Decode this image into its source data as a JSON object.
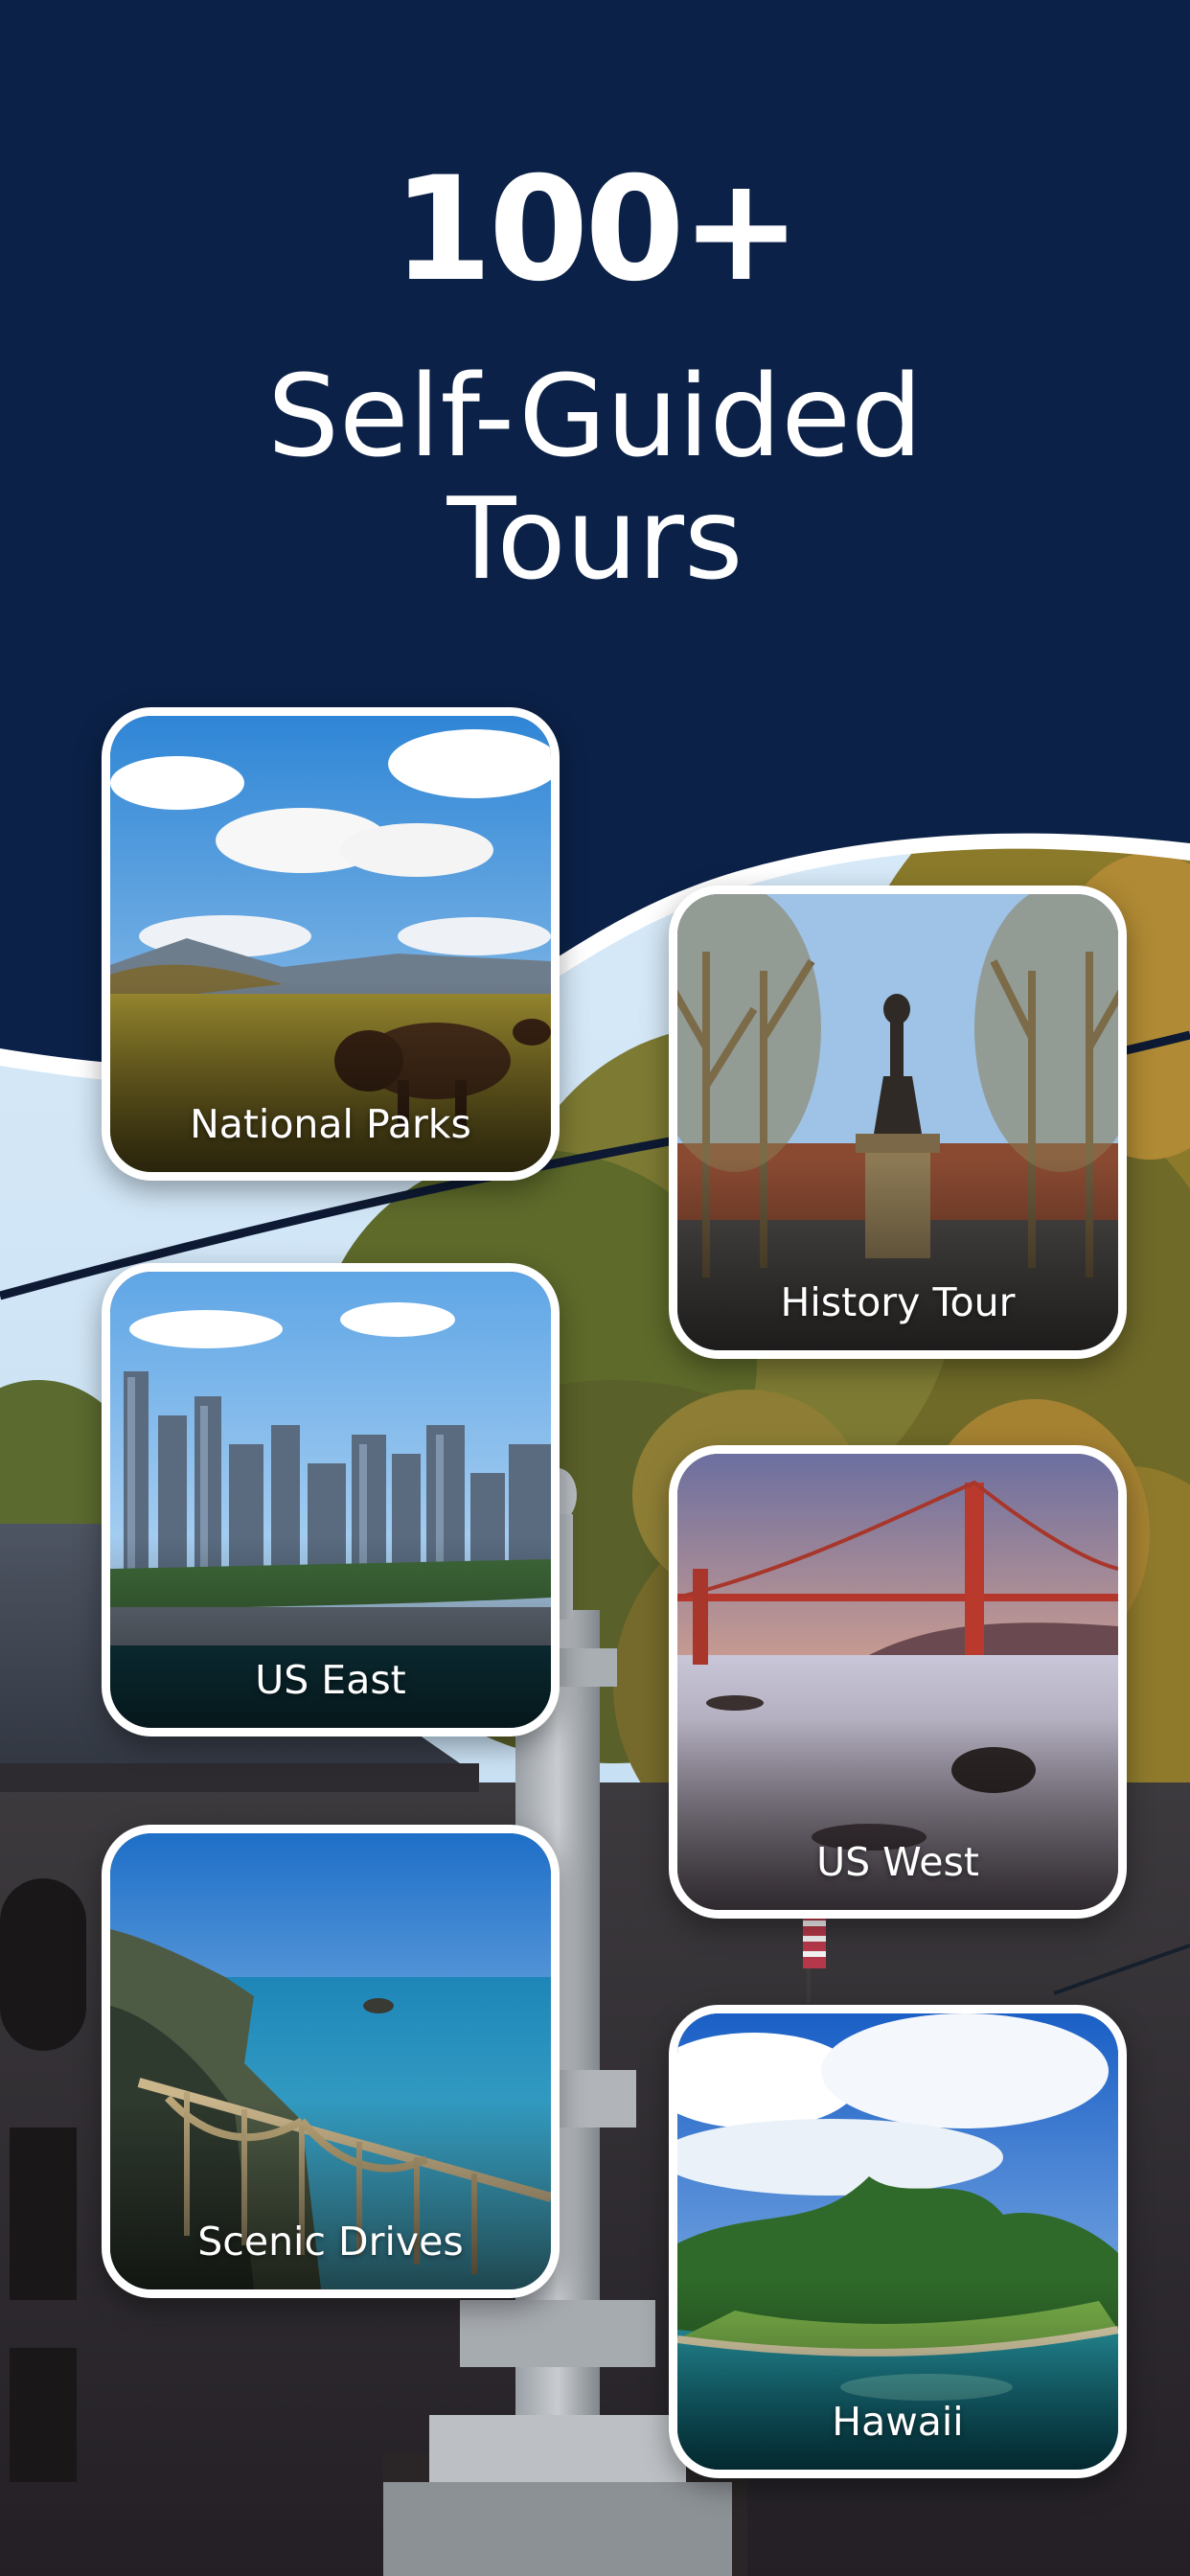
{
  "hero": {
    "count": "100+",
    "title_line1": "Self-Guided",
    "title_line2": "Tours"
  },
  "cards": [
    {
      "label": "National Parks"
    },
    {
      "label": "History Tour"
    },
    {
      "label": "US East"
    },
    {
      "label": "US West"
    },
    {
      "label": "Scenic Drives"
    },
    {
      "label": "Hawaii"
    }
  ],
  "colors": {
    "navy": "#0b2147",
    "sky": "#d7ebfb",
    "card_border": "#ffffff",
    "text": "#ffffff"
  }
}
